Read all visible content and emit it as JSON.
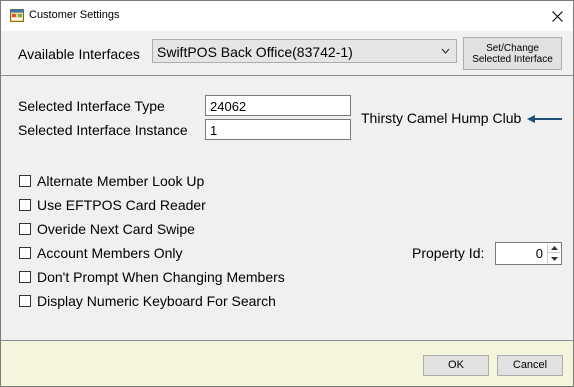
{
  "window": {
    "title": "Customer Settings",
    "title_icon": "app-window-icon",
    "close_icon": "close-icon"
  },
  "toolbar": {
    "interfaces_label": "Available Interfaces",
    "selected_interface": "SwiftPOS Back Office(83742-1)",
    "dropdown_icon": "chevron-down-icon",
    "set_change_label_line1": "Set/Change",
    "set_change_label_line2": "Selected Interface"
  },
  "form": {
    "interface_type_label": "Selected Interface Type",
    "interface_type_value": "24062",
    "interface_instance_label": "Selected Interface Instance",
    "interface_instance_value": "1",
    "club_name": "Thirsty Camel Hump Club",
    "arrow_icon": "arrow-left-icon",
    "arrow_color": "#1f4e79"
  },
  "options": [
    {
      "label": "Alternate Member Look Up",
      "checked": false
    },
    {
      "label": "Use EFTPOS Card Reader",
      "checked": false
    },
    {
      "label": "Overide Next Card Swipe",
      "checked": false
    },
    {
      "label": "Account Members Only",
      "checked": false
    },
    {
      "label": "Don't Prompt When Changing Members",
      "checked": false
    },
    {
      "label": "Display Numeric Keyboard For Search",
      "checked": false
    }
  ],
  "property": {
    "label": "Property Id:",
    "value": "0"
  },
  "footer": {
    "ok_label": "OK",
    "cancel_label": "Cancel",
    "background": "#f5f5dc"
  }
}
